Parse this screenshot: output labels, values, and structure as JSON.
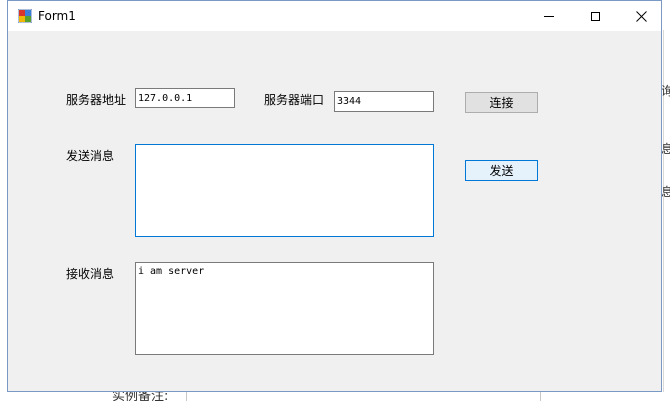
{
  "window": {
    "title": "Form1"
  },
  "form": {
    "server_address_label": "服务器地址",
    "server_address_value": "127.0.0.1",
    "server_port_label": "服务器端口",
    "server_port_value": "3344",
    "connect_button": "连接",
    "send_message_label": "发送消息",
    "send_message_value": "",
    "send_button": "发送",
    "receive_message_label": "接收消息",
    "receive_message_value": "i am server"
  },
  "background": {
    "bottom_text": "实例备注:",
    "right_texts": [
      "询",
      "息",
      "息"
    ]
  },
  "colors": {
    "window_border": "#7a9ac3",
    "client_bg": "#f0f0f0",
    "focus_accent": "#0078d7"
  },
  "icons": {
    "app": "form-app-icon",
    "minimize": "minimize-icon",
    "maximize": "maximize-icon",
    "close": "close-icon"
  }
}
